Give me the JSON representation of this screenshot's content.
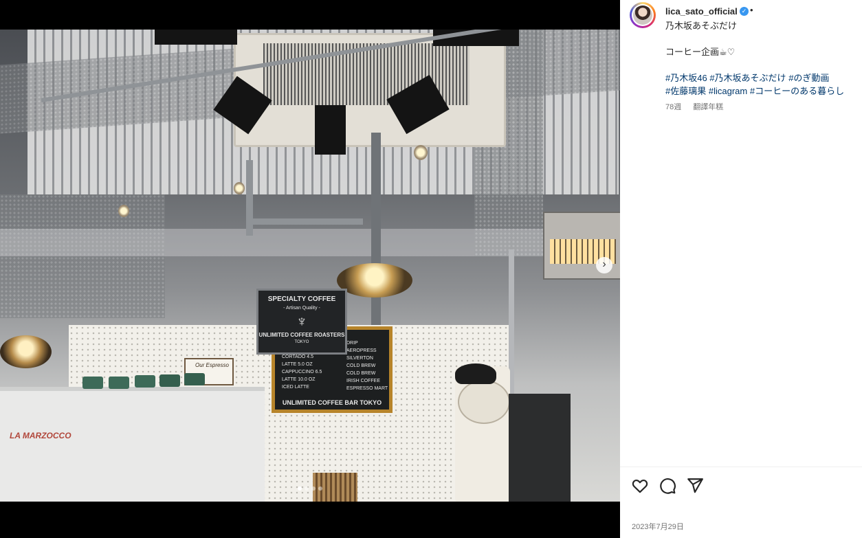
{
  "post": {
    "username": "lica_sato_official",
    "verified_symbol": "✓",
    "separator": "•",
    "caption_title": "乃木坂あそぶだけ",
    "caption_body": "コーヒー企画☕♡",
    "hashtags_line1": [
      "#乃木坂46",
      "#乃木坂あそぶだけ",
      "#のぎ動画"
    ],
    "hashtags_line2": [
      "#佐藤璃果",
      "#licagram",
      "#コーヒーのある暮らし"
    ],
    "age": "78週",
    "translate_label": "翻譯年糕",
    "date": "2023年7月29日"
  },
  "media": {
    "next_arrow": "›",
    "carousel_dots": 4,
    "active_dot": 0,
    "sign_specialty": {
      "title": "SPECIALTY COFFEE",
      "subtitle": "- Artisan Quality -",
      "footer": "UNLIMITED COFFEE ROASTERS",
      "city": "TOKYO"
    },
    "sign_menu": {
      "left_items": [
        "CORTADO 4.5",
        "LATTE 5.0 OZ",
        "CAPPUCCINO 6.5",
        "LATTE 10.0 OZ",
        "ICED LATTE"
      ],
      "right_items": [
        "DRIP",
        "AEROPRESS",
        "SILVERTON",
        "COLD BREW",
        "COLD BREW",
        "IRISH COFFEE",
        "ESPRESSO MART"
      ],
      "footer": "UNLIMITED COFFEE BAR TOKYO"
    },
    "machine_brand": "LA MARZOCCO",
    "side_sign": "Our Espresso"
  },
  "actions": {
    "like_icon": "heart-icon",
    "comment_icon": "comment-icon",
    "share_icon": "send-icon"
  },
  "colors": {
    "hashtag": "#00376b",
    "verified": "#3897f0",
    "secondary_text": "#737373"
  }
}
